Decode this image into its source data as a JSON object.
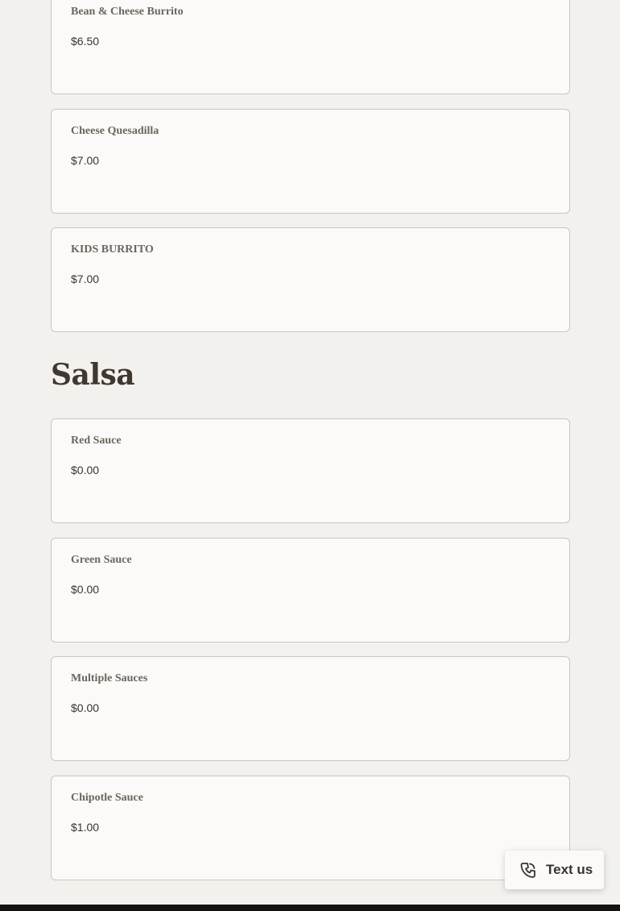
{
  "groups": [
    {
      "items": [
        {
          "name": "Bean & Cheese Burrito",
          "price": "$6.50"
        },
        {
          "name": "Cheese Quesadilla",
          "price": "$7.00"
        },
        {
          "name": "KIDS BURRITO",
          "price": "$7.00"
        }
      ]
    },
    {
      "title": "Salsa",
      "items": [
        {
          "name": "Red Sauce",
          "price": "$0.00"
        },
        {
          "name": "Green Sauce",
          "price": "$0.00"
        },
        {
          "name": "Multiple Sauces",
          "price": "$0.00"
        },
        {
          "name": "Chipotle Sauce",
          "price": "$1.00"
        }
      ]
    }
  ],
  "text_us": {
    "label": "Text us",
    "icon": "chat-phone-icon"
  },
  "colors": {
    "background": "#f2f1ed",
    "card_background": "#fbfaf8",
    "card_border": "#c9c6c0",
    "item_name": "#6d655c",
    "heading": "#3f3730",
    "footer": "#151311"
  }
}
